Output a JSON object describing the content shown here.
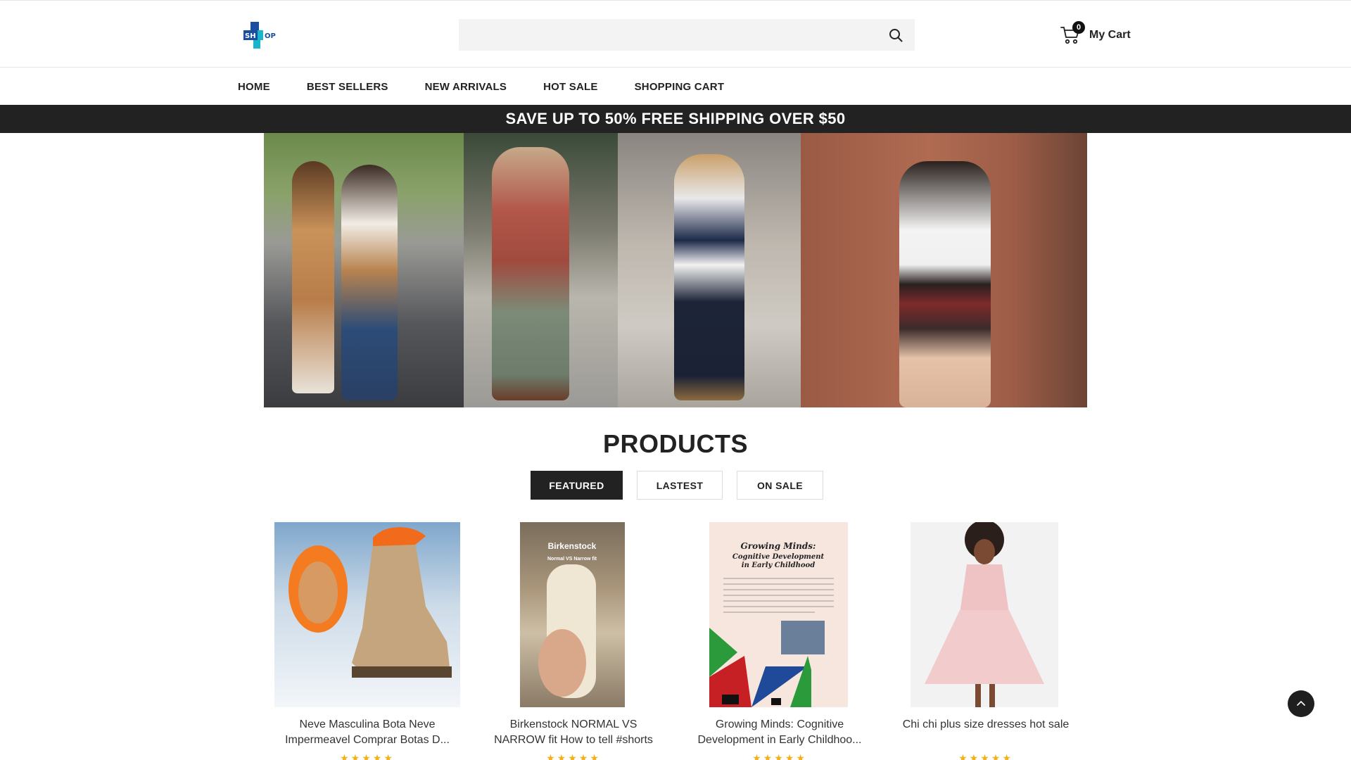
{
  "header": {
    "logo_text_left": "SH",
    "logo_text_right": "OP",
    "search": {
      "value": "",
      "placeholder": ""
    },
    "cart": {
      "label": "My Cart",
      "count": "0"
    }
  },
  "nav": {
    "items": [
      {
        "label": "HOME"
      },
      {
        "label": "BEST SELLERS"
      },
      {
        "label": "NEW ARRIVALS"
      },
      {
        "label": "HOT SALE"
      },
      {
        "label": "SHOPPING CART"
      }
    ]
  },
  "announcement": {
    "text": "SAVE UP TO 50% FREE SHIPPING OVER $50"
  },
  "products_section": {
    "title": "PRODUCTS",
    "tabs": [
      {
        "label": "FEATURED",
        "active": true
      },
      {
        "label": "LASTEST",
        "active": false
      },
      {
        "label": "ON SALE",
        "active": false
      }
    ],
    "items": [
      {
        "title_line1": "Neve Masculina Bota Neve",
        "title_line2": "Impermeavel Comprar Botas D...",
        "rating": 5
      },
      {
        "title_line1": "Birkenstock NORMAL VS",
        "title_line2": "NARROW fit How to tell #shorts",
        "rating": 5,
        "thumb_text_1": "Birkenstock",
        "thumb_text_2": "Normal VS Narrow fit"
      },
      {
        "title_line1": "Growing Minds: Cognitive",
        "title_line2": "Development in Early Childhoo...",
        "rating": 5,
        "thumb_text_1": "Growing Minds:",
        "thumb_text_2": "Cognitive Development",
        "thumb_text_3": "in Early Childhood"
      },
      {
        "title_line1": "Chi chi plus size dresses hot sale",
        "title_line2": "",
        "rating": 5
      }
    ]
  },
  "colors": {
    "dark": "#222222",
    "star": "#f2b01e",
    "logo_blue": "#1a4fa0",
    "logo_teal": "#19b5c9"
  }
}
